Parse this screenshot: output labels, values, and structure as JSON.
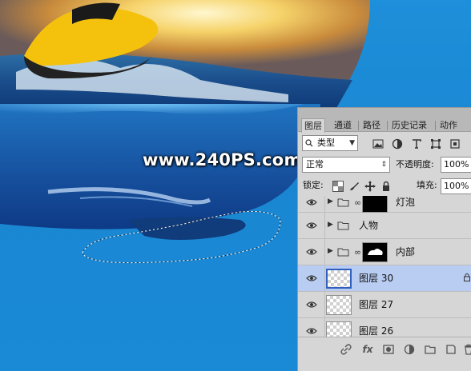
{
  "canvas": {
    "watermark": "www.240PS.com"
  },
  "layers_panel": {
    "tabs": [
      {
        "label": "图层",
        "active": true
      },
      {
        "label": "通道",
        "active": false
      },
      {
        "label": "路径",
        "active": false
      },
      {
        "label": "历史记录",
        "active": false
      },
      {
        "label": "动作",
        "active": false
      }
    ],
    "filter": {
      "search_icon": "search-icon",
      "kind_value": "类型"
    },
    "blend_mode": "正常",
    "opacity_label": "不透明度:",
    "opacity_value": "100%",
    "lock_label": "锁定:",
    "fill_label": "填充:",
    "fill_value": "100%",
    "layers": [
      {
        "name": "灯泡",
        "type": "group",
        "linked_mask": true,
        "visible": true
      },
      {
        "name": "人物",
        "type": "group",
        "visible": true
      },
      {
        "name": "内部",
        "type": "group",
        "linked_mask": true,
        "visible": true
      },
      {
        "name": "图层 30",
        "type": "layer",
        "selected": true,
        "visible": true
      },
      {
        "name": "图层 27",
        "type": "layer",
        "visible": true
      },
      {
        "name": "图层 26",
        "type": "layer",
        "visible": true
      }
    ],
    "bottom_icons": [
      "link-icon",
      "fx-icon",
      "mask-icon",
      "adjustment-icon",
      "group-folder-icon",
      "new-layer-icon",
      "trash-icon"
    ],
    "bottom_fx_label": "fx",
    "colors": {
      "panel_bg": "#d6d6d6",
      "tab_bar": "#b8b8b8",
      "selected_row": "#b9cdf2"
    }
  }
}
